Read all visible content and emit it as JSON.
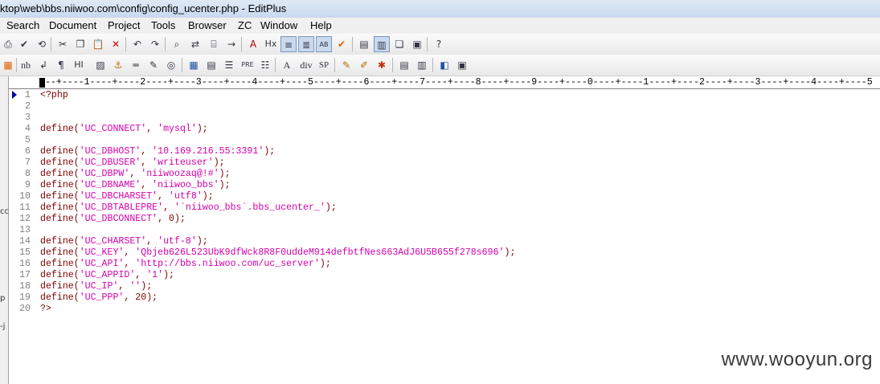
{
  "window": {
    "title": "ktop\\web\\bbs.niiwoo.com\\config\\config_ucenter.php - EditPlus"
  },
  "menu": [
    "Search",
    "Document",
    "Project",
    "Tools",
    "Browser",
    "ZC",
    "Window",
    "Help"
  ],
  "toolbar1": [
    "print-icon",
    "spellcheck-icon",
    "new-browser-icon",
    "cut-icon",
    "copy-icon",
    "paste-icon",
    "delete-icon",
    "undo-icon",
    "redo-icon",
    "find-icon",
    "replace-icon",
    "find-in-files-icon",
    "goto-icon",
    "font-icon",
    "hx-icon",
    "word-wrap-icon",
    "line-number-icon",
    "column-select-icon",
    "check-icon",
    "window-icon",
    "tile-icon",
    "cascade-icon",
    "browser-icon",
    "help-icon"
  ],
  "toolbar2": {
    "nb": "nb",
    "hx": "Hx",
    "para": "¶",
    "hi": "HI",
    "pre": "PRE",
    "div": "div",
    "sp": "SP",
    "font_a": "A"
  },
  "ruler": {
    "text": "---+----1----+----2----+----3----+----4----+----5----+----6----+----7----+----8----+----9----+----0----+----1----+----2----+----3----+----4----+----5"
  },
  "left_pane": {
    "fragments": [
      "cc",
      "p",
      "-j"
    ]
  },
  "editor": {
    "lines": [
      {
        "n": "1",
        "segments": [
          {
            "t": "<?php",
            "c": "tag"
          }
        ]
      },
      {
        "n": "2",
        "segments": []
      },
      {
        "n": "3",
        "segments": []
      },
      {
        "n": "4",
        "segments": [
          {
            "t": "define(",
            "c": "kw"
          },
          {
            "t": "'UC_CONNECT'",
            "c": "st"
          },
          {
            "t": ", ",
            "c": "pn"
          },
          {
            "t": "'mysql'",
            "c": "st"
          },
          {
            "t": ");",
            "c": "pn"
          }
        ]
      },
      {
        "n": "5",
        "segments": []
      },
      {
        "n": "6",
        "segments": [
          {
            "t": "define(",
            "c": "kw"
          },
          {
            "t": "'UC_DBHOST'",
            "c": "st"
          },
          {
            "t": ", ",
            "c": "pn"
          },
          {
            "t": "'10.169.216.55:3391'",
            "c": "st"
          },
          {
            "t": ");",
            "c": "pn"
          }
        ]
      },
      {
        "n": "7",
        "segments": [
          {
            "t": "define(",
            "c": "kw"
          },
          {
            "t": "'UC_DBUSER'",
            "c": "st"
          },
          {
            "t": ", ",
            "c": "pn"
          },
          {
            "t": "'writeuser'",
            "c": "st"
          },
          {
            "t": ");",
            "c": "pn"
          }
        ]
      },
      {
        "n": "8",
        "segments": [
          {
            "t": "define(",
            "c": "kw"
          },
          {
            "t": "'UC_DBPW'",
            "c": "st"
          },
          {
            "t": ", ",
            "c": "pn"
          },
          {
            "t": "'niiwoozaq@!#'",
            "c": "st"
          },
          {
            "t": ");",
            "c": "pn"
          }
        ]
      },
      {
        "n": "9",
        "segments": [
          {
            "t": "define(",
            "c": "kw"
          },
          {
            "t": "'UC_DBNAME'",
            "c": "st"
          },
          {
            "t": ", ",
            "c": "pn"
          },
          {
            "t": "'niiwoo_bbs'",
            "c": "st"
          },
          {
            "t": ");",
            "c": "pn"
          }
        ]
      },
      {
        "n": "10",
        "segments": [
          {
            "t": "define(",
            "c": "kw"
          },
          {
            "t": "'UC_DBCHARSET'",
            "c": "st"
          },
          {
            "t": ", ",
            "c": "pn"
          },
          {
            "t": "'utf8'",
            "c": "st"
          },
          {
            "t": ");",
            "c": "pn"
          }
        ]
      },
      {
        "n": "11",
        "segments": [
          {
            "t": "define(",
            "c": "kw"
          },
          {
            "t": "'UC_DBTABLEPRE'",
            "c": "st"
          },
          {
            "t": ", ",
            "c": "pn"
          },
          {
            "t": "'`niiwoo_bbs`.bbs_ucenter_'",
            "c": "st"
          },
          {
            "t": ");",
            "c": "pn"
          }
        ]
      },
      {
        "n": "12",
        "segments": [
          {
            "t": "define(",
            "c": "kw"
          },
          {
            "t": "'UC_DBCONNECT'",
            "c": "st"
          },
          {
            "t": ", ",
            "c": "pn"
          },
          {
            "t": "0",
            "c": "nm"
          },
          {
            "t": ");",
            "c": "pn"
          }
        ]
      },
      {
        "n": "13",
        "segments": []
      },
      {
        "n": "14",
        "segments": [
          {
            "t": "define(",
            "c": "kw"
          },
          {
            "t": "'UC_CHARSET'",
            "c": "st"
          },
          {
            "t": ", ",
            "c": "pn"
          },
          {
            "t": "'utf-8'",
            "c": "st"
          },
          {
            "t": ");",
            "c": "pn"
          }
        ]
      },
      {
        "n": "15",
        "segments": [
          {
            "t": "define(",
            "c": "kw"
          },
          {
            "t": "'UC_KEY'",
            "c": "st"
          },
          {
            "t": ", ",
            "c": "pn"
          },
          {
            "t": "'Qbjeb626L523UbK9dfWck8R8F0uddeM914defbtfNes663AdJ6U5B655f278s696'",
            "c": "st"
          },
          {
            "t": ");",
            "c": "pn"
          }
        ]
      },
      {
        "n": "16",
        "segments": [
          {
            "t": "define(",
            "c": "kw"
          },
          {
            "t": "'UC_API'",
            "c": "st"
          },
          {
            "t": ", ",
            "c": "pn"
          },
          {
            "t": "'http://bbs.niiwoo.com/uc_server'",
            "c": "st"
          },
          {
            "t": ");",
            "c": "pn"
          }
        ]
      },
      {
        "n": "17",
        "segments": [
          {
            "t": "define(",
            "c": "kw"
          },
          {
            "t": "'UC_APPID'",
            "c": "st"
          },
          {
            "t": ", ",
            "c": "pn"
          },
          {
            "t": "'1'",
            "c": "st"
          },
          {
            "t": ");",
            "c": "pn"
          }
        ]
      },
      {
        "n": "18",
        "segments": [
          {
            "t": "define(",
            "c": "kw"
          },
          {
            "t": "'UC_IP'",
            "c": "st"
          },
          {
            "t": ", ",
            "c": "pn"
          },
          {
            "t": "''",
            "c": "st"
          },
          {
            "t": ");",
            "c": "pn"
          }
        ]
      },
      {
        "n": "19",
        "segments": [
          {
            "t": "define(",
            "c": "kw"
          },
          {
            "t": "'UC_PPP'",
            "c": "st"
          },
          {
            "t": ", ",
            "c": "pn"
          },
          {
            "t": "20",
            "c": "nm"
          },
          {
            "t": ");",
            "c": "pn"
          }
        ]
      },
      {
        "n": "20",
        "segments": [
          {
            "t": "?>",
            "c": "tag"
          }
        ]
      }
    ]
  },
  "watermark": "www.wooyun.org"
}
